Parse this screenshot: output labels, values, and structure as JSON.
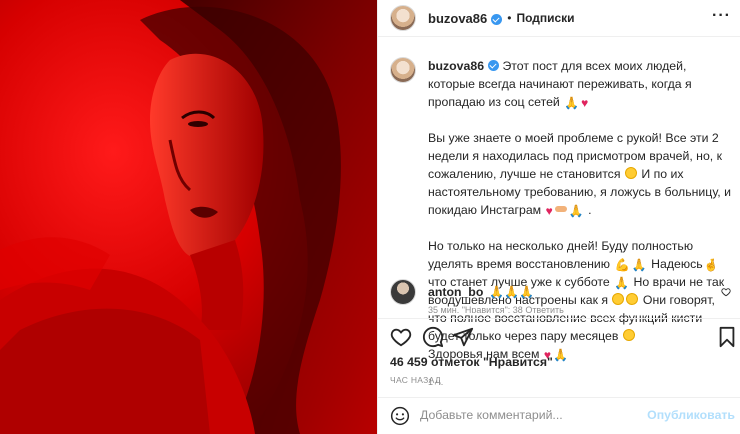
{
  "header": {
    "username": "buzova86",
    "separator": "•",
    "follow_label": "Подписки",
    "more_icon": "more-horizontal-icon"
  },
  "caption": {
    "username": "buzova86",
    "p1": "Этот пост для всех моих людей, которые всегда начинают переживать, когда я пропадаю из соц сетей",
    "p2a": "Вы уже знаете о моей проблеме с рукой! Все эти 2 недели я находилась под присмотром врачей, но, к сожалению, лучше не становится",
    "p2b": "И по их настоятельному требованию, я ложусь в больницу, и покидаю Инстаграм",
    "p2c": ".",
    "p3a": "Но только на несколько дней! Буду полностью уделять время восстановлению",
    "p3b": "Надеюсь",
    "p3c": "что станет лучше уже к субботе",
    "p3d": "Но врачи не так воодушевлено настроены как я",
    "p3e": "Они говорят, что полное восстановление всех функций кисти будет только через пару месяцев",
    "p3f": "Здоровья нам всем",
    "time": "1 ч."
  },
  "comment": {
    "username": "anton_bo",
    "text": "🙏🙏🙏",
    "meta": "35 мин.    \"Нравится\": 38    Ответить"
  },
  "actions": {
    "likes": "46 459 отметок \"Нравится\"",
    "ago": "ЧАС НАЗАД"
  },
  "add_comment": {
    "placeholder": "Добавьте комментарий...",
    "publish_label": "Опубликовать"
  },
  "colors": {
    "accent": "#3897f0",
    "photo_red": "#c40000",
    "publish_disabled": "#b2dffc"
  }
}
